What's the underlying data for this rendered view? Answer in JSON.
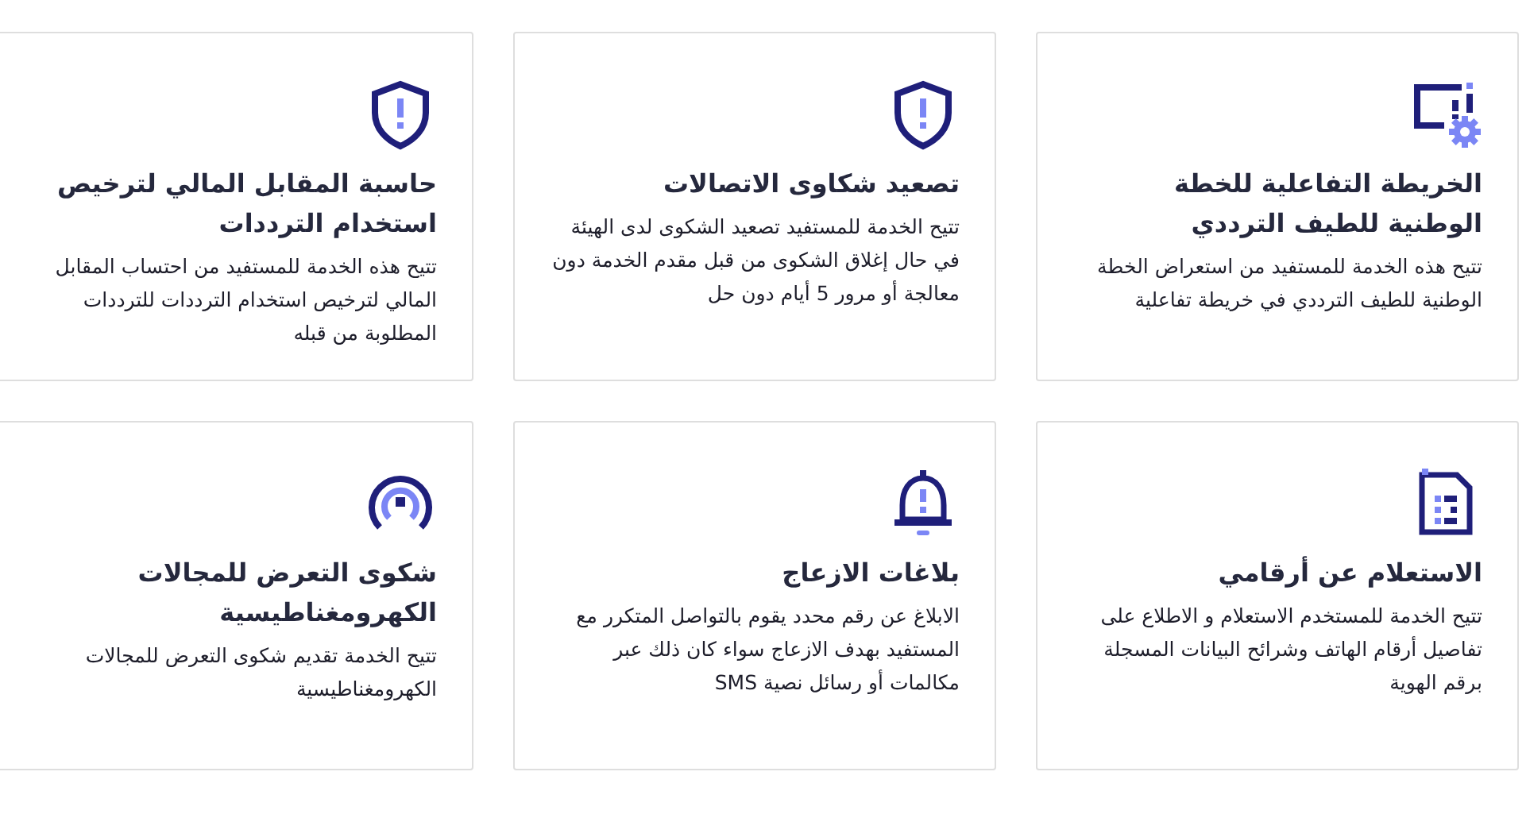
{
  "services": [
    {
      "kind": "map-settings",
      "title": "الخريطة التفاعلية للخطة الوطنية للطيف الترددي",
      "description": "تتيح هذه الخدمة للمستفيد من استعراض الخطة الوطنية للطيف الترددي في خريطة تفاعلية"
    },
    {
      "kind": "shield",
      "title": "تصعيد شكاوى الاتصالات",
      "description": "تتيح الخدمة للمستفيد تصعيد الشكوى لدى الهيئة في حال إغلاق الشكوى من قبل مقدم الخدمة دون معالجة أو مرور 5 أيام دون حل"
    },
    {
      "kind": "shield",
      "title": "حاسبة المقابل المالي لترخيص استخدام الترددات",
      "description": "تتيح هذه الخدمة للمستفيد من احتساب المقابل المالي لترخيص استخدام الترددات للترددات المطلوبة من قبله"
    },
    {
      "kind": "sim",
      "title": "الاستعلام عن أرقامي",
      "description": "تتيح الخدمة للمستخدم الاستعلام و الاطلاع على تفاصيل أرقام الهاتف وشرائح البيانات المسجلة برقم الهوية"
    },
    {
      "kind": "bell",
      "title": "بلاغات الازعاج",
      "description": "الابلاغ عن رقم محدد يقوم بالتواصل المتكرر مع المستفيد بهدف الازعاج سواء كان ذلك عبر مكالمات أو رسائل نصية SMS"
    },
    {
      "kind": "signal",
      "title": "شكوى التعرض للمجالات الكهرومغناطيسية",
      "description": "تتيح الخدمة تقديم شكوى التعرض للمجالات الكهرومغناطيسية"
    }
  ]
}
